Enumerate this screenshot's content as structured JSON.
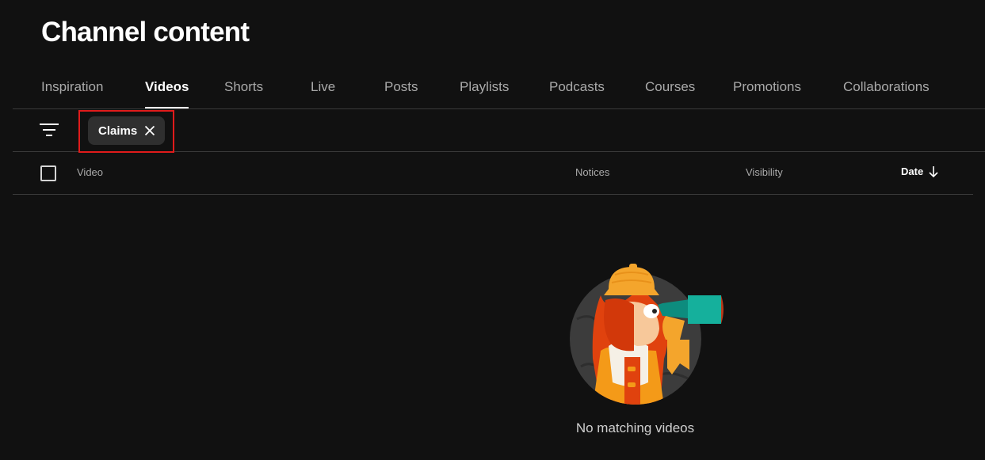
{
  "page": {
    "title": "Channel content"
  },
  "tabs": [
    {
      "label": "Inspiration",
      "active": false
    },
    {
      "label": "Videos",
      "active": true
    },
    {
      "label": "Shorts",
      "active": false
    },
    {
      "label": "Live",
      "active": false
    },
    {
      "label": "Posts",
      "active": false
    },
    {
      "label": "Playlists",
      "active": false
    },
    {
      "label": "Podcasts",
      "active": false
    },
    {
      "label": "Courses",
      "active": false
    },
    {
      "label": "Promotions",
      "active": false
    },
    {
      "label": "Collaborations",
      "active": false
    }
  ],
  "filter_bar": {
    "filter_icon": "filter-icon",
    "chip": {
      "label": "Claims",
      "close_icon": "close-icon"
    }
  },
  "table": {
    "columns": {
      "video": "Video",
      "notices": "Notices",
      "visibility": "Visibility",
      "date": "Date"
    },
    "sort_icon": "arrow-down-icon"
  },
  "empty_state": {
    "message": "No matching videos",
    "illustration": "explorer-with-telescope-illustration"
  },
  "colors": {
    "background": "#111111",
    "divider": "#3a3a3a",
    "chip_bg": "#2f2f2f",
    "highlight": "#e01b1b",
    "muted_text": "#aaaaaa"
  }
}
